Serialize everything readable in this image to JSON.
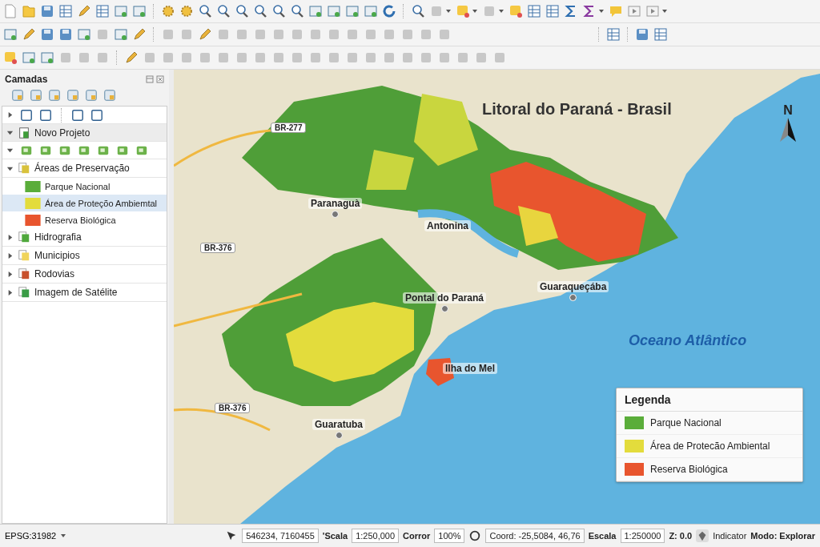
{
  "layers_panel": {
    "title": "Camadas",
    "tree": [
      {
        "label": "Novo Projeto",
        "expanded": true,
        "selected": false,
        "color": "#3f9d3a",
        "children": [
          {
            "label": "Áreas de Preservação",
            "expanded": true,
            "selected": false,
            "color": "#d9c23c",
            "children": [
              {
                "label": "Parque Nacional",
                "selected": false,
                "color": "#5aad3a"
              },
              {
                "label": "Área de Proteçõo Ambiemtal",
                "selected": true,
                "color": "#e3dc3c"
              },
              {
                "label": "Reserva Biológica",
                "selected": false,
                "color": "#e8552e"
              }
            ]
          },
          {
            "label": "Hidrografia",
            "expanded": false,
            "selected": false,
            "color": "#4fa83c"
          },
          {
            "label": "Municipios",
            "expanded": false,
            "selected": false,
            "color": "#f0d45a"
          },
          {
            "label": "Rodovias",
            "expanded": false,
            "selected": false,
            "color": "#c8502c"
          },
          {
            "label": "Imagem de Satélite",
            "expanded": false,
            "selected": false,
            "color": "#3a9c46"
          }
        ]
      }
    ]
  },
  "map": {
    "labels": [
      {
        "text": "Litoral do Paraná - Brasil",
        "kind": "title"
      },
      {
        "text": "BR-277",
        "kind": "road"
      },
      {
        "text": "BR-376",
        "kind": "road"
      },
      {
        "text": "BR-376",
        "kind": "road"
      },
      {
        "text": "Paranaguà",
        "kind": "city"
      },
      {
        "text": "Antonina",
        "kind": "town"
      },
      {
        "text": "Guaraqueçába",
        "kind": "city"
      },
      {
        "text": "Pontal do Paraná",
        "kind": "city"
      },
      {
        "text": "Ilha do Mel",
        "kind": "town"
      },
      {
        "text": "Guaratuba",
        "kind": "city"
      },
      {
        "text": "Oceano Atlântico",
        "kind": "sea"
      }
    ],
    "north_label": "N",
    "legend": {
      "title": "Legenda",
      "items": [
        {
          "label": "Parque Nacional",
          "color": "#5aad3a"
        },
        {
          "label": "Área de Protecão Ambiental",
          "color": "#e3dc3c"
        },
        {
          "label": "Reserva Biológica",
          "color": "#e8552e"
        }
      ]
    }
  },
  "status_bar": {
    "crs": "EPSG:31982",
    "coordinate": "546234, 7160455",
    "scale_label": "'Scala",
    "scale": "1:250,000",
    "zoom_label": "Corror",
    "zoom": "100%",
    "coord": "Coord: -25,5084,  46,76",
    "scale2_label": "Escala",
    "scale2": "1:250000",
    "z": "Z: 0.0",
    "indicator_label": "Indicator",
    "mode": "Modo: Explorar"
  }
}
